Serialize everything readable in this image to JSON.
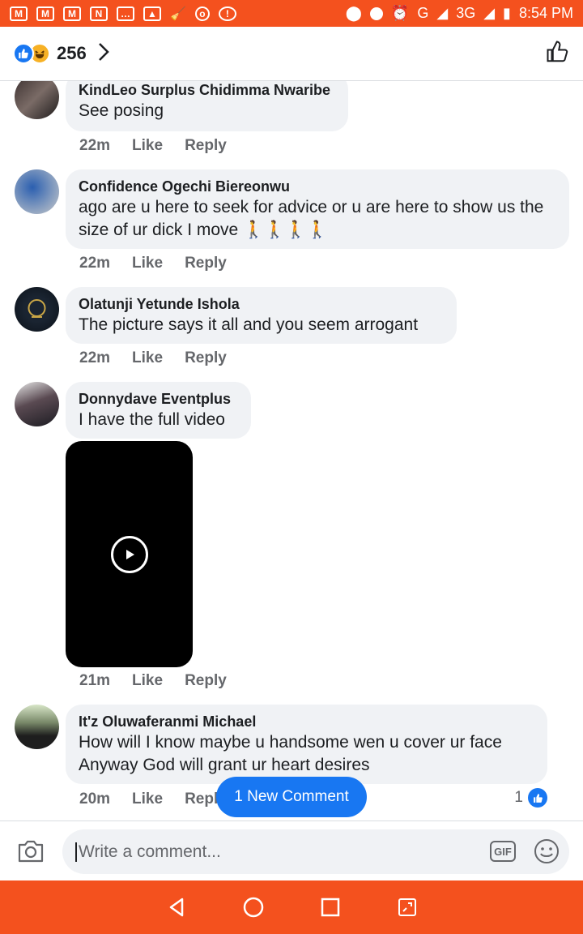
{
  "status_bar": {
    "network": "G",
    "network2": "3G",
    "time": "8:54 PM"
  },
  "header": {
    "reaction_count": "256"
  },
  "comments": [
    {
      "author": "KindLeo Surplus Chidimma Nwaribe",
      "text": "See posing",
      "time": "22m"
    },
    {
      "author": "Confidence Ogechi Biereonwu",
      "text": "ago are u here to seek for advice or u are here to show us the size of ur dick I move 🚶🚶🚶🚶",
      "time": "22m"
    },
    {
      "author": "Olatunji Yetunde Ishola",
      "text": "The picture says it all and you seem arrogant",
      "time": "22m"
    },
    {
      "author": "Donnydave Eventplus",
      "text": "I have the full video",
      "time": "21m"
    },
    {
      "author": "It'z Oluwaferanmi Michael",
      "text": "How will I know maybe u handsome wen u cover ur face Anyway God will grant ur heart desires",
      "time": "20m",
      "reactions": "1"
    }
  ],
  "actions": {
    "like": "Like",
    "reply": "Reply"
  },
  "new_comment_pill": "1 New Comment",
  "composer": {
    "placeholder": "Write a comment...",
    "gif": "GIF"
  },
  "colors": {
    "accent": "#1877f2",
    "system_bar": "#f4511e",
    "bubble": "#f0f2f5"
  }
}
